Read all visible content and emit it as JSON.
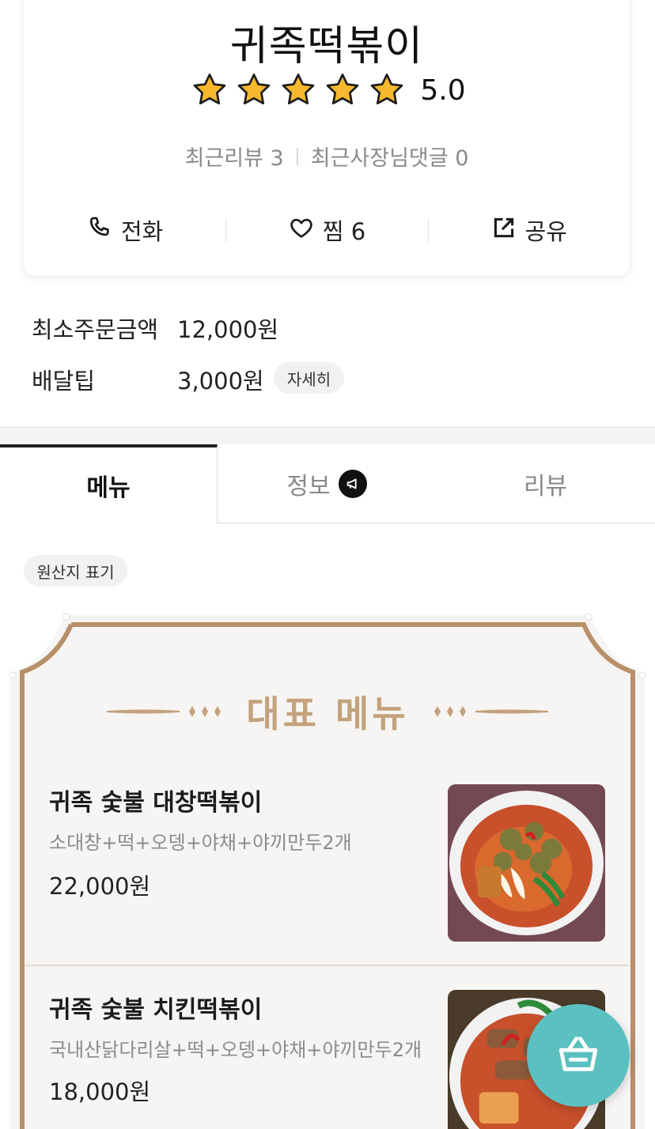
{
  "store": {
    "name": "귀족떡볶이",
    "rating": "5.0",
    "stars": 5,
    "recent_reviews": "최근리뷰 3",
    "owner_replies": "최근사장님댓글 0"
  },
  "actions": {
    "call_label": "전화",
    "favorite_label": "찜 6",
    "share_label": "공유"
  },
  "order_info": {
    "min_order_label": "최소주문금액",
    "min_order_value": "12,000원",
    "delivery_tip_label": "배달팁",
    "delivery_tip_value": "3,000원",
    "detail_label": "자세히"
  },
  "tabs": [
    {
      "label": "메뉴",
      "active": true
    },
    {
      "label": "정보",
      "active": false
    },
    {
      "label": "리뷰",
      "active": false
    }
  ],
  "origin_label": "원산지 표기",
  "featured": {
    "title": "대표 메뉴",
    "items": [
      {
        "name": "귀족 숯불 대창떡볶이",
        "desc": "소대창+떡+오뎅+야채+야끼만두2개",
        "price": "22,000원"
      },
      {
        "name": "귀족 숯불 치킨떡볶이",
        "desc": "국내산닭다리살+떡+오뎅+야채+야끼만두2개",
        "price": "18,000원"
      }
    ]
  },
  "colors": {
    "accent_gold": "#c3a27c",
    "frame_brown": "#b8906a",
    "cart_teal": "#5bc0c0",
    "star_yellow": "#f5b82e"
  },
  "icons": {
    "call": "phone-icon",
    "favorite": "heart-icon",
    "share": "share-icon",
    "info_badge": "megaphone-icon",
    "cart": "basket-icon"
  }
}
